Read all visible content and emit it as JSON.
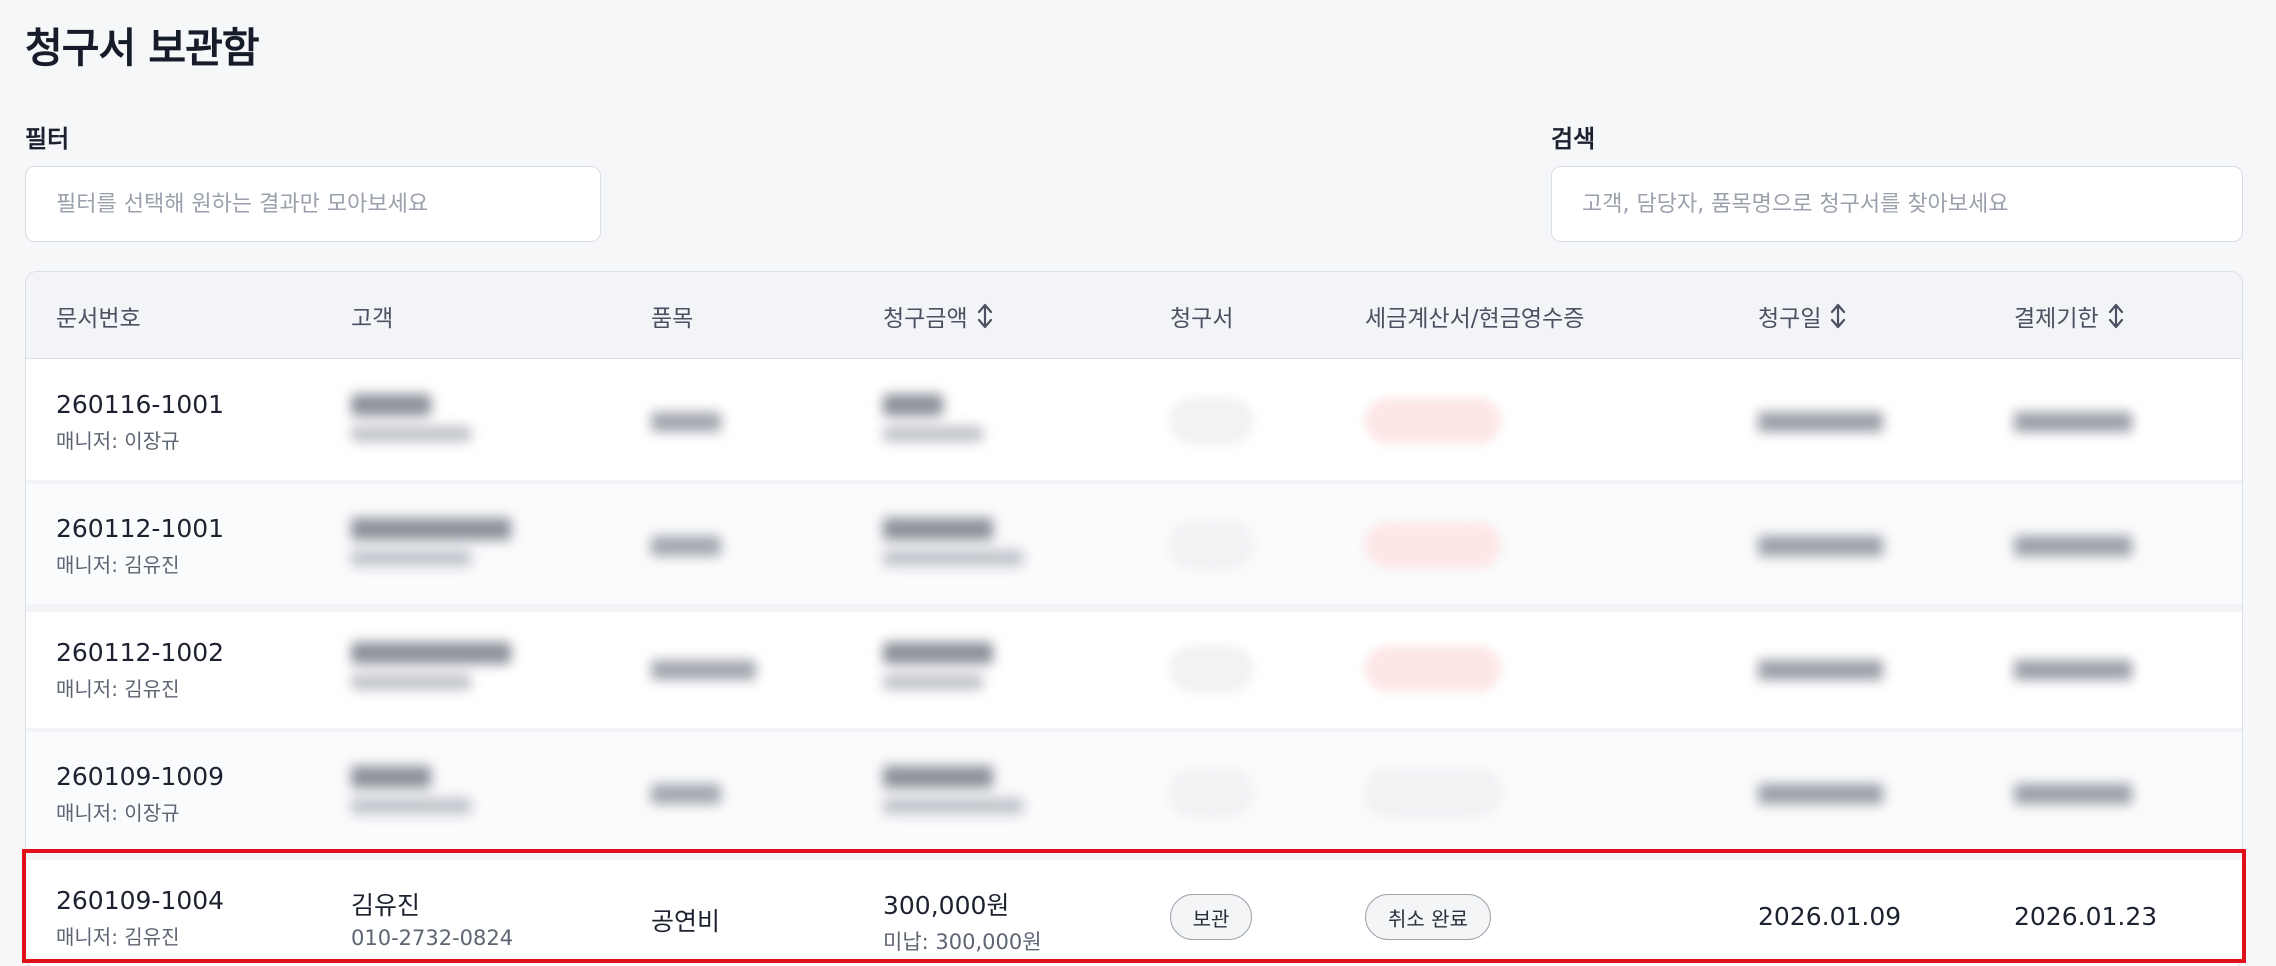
{
  "page": {
    "title": "청구서 보관함"
  },
  "filter": {
    "label": "필터",
    "placeholder": "필터를 선택해 원하는 결과만 모아보세요",
    "value": ""
  },
  "search": {
    "label": "검색",
    "placeholder": "고객, 담당자, 품목명으로 청구서를 찾아보세요",
    "value": ""
  },
  "table": {
    "columns": [
      {
        "label": "문서번호",
        "sortable": false
      },
      {
        "label": "고객",
        "sortable": false
      },
      {
        "label": "품목",
        "sortable": false
      },
      {
        "label": "청구금액",
        "sortable": true
      },
      {
        "label": "청구서",
        "sortable": false
      },
      {
        "label": "세금계산서/현금영수증",
        "sortable": false
      },
      {
        "label": "청구일",
        "sortable": true
      },
      {
        "label": "결제기한",
        "sortable": true
      }
    ],
    "rows": [
      {
        "doc_no": "260116-1001",
        "manager": "매니저: 이장규",
        "customer_name": "",
        "customer_phone": "",
        "item": "",
        "amount": "",
        "unpaid": "",
        "invoice_status": "",
        "tax_status": "",
        "billed_date": "",
        "due_date": "",
        "blurred": true,
        "tax_color": "#d23a3a"
      },
      {
        "doc_no": "260112-1001",
        "manager": "매니저: 김유진",
        "customer_name": "",
        "customer_phone": "",
        "item": "",
        "amount": "",
        "unpaid": "",
        "invoice_status": "",
        "tax_status": "",
        "billed_date": "",
        "due_date": "",
        "blurred": true,
        "tax_color": "#d23a3a"
      },
      {
        "doc_no": "260112-1002",
        "manager": "매니저: 김유진",
        "customer_name": "",
        "customer_phone": "",
        "item": "",
        "amount": "",
        "unpaid": "",
        "invoice_status": "",
        "tax_status": "",
        "billed_date": "",
        "due_date": "",
        "blurred": true,
        "tax_color": "#d23a3a"
      },
      {
        "doc_no": "260109-1009",
        "manager": "매니저: 이장규",
        "customer_name": "",
        "customer_phone": "",
        "item": "",
        "amount": "",
        "unpaid": "",
        "invoice_status": "",
        "tax_status": "",
        "billed_date": "",
        "due_date": "",
        "blurred": true,
        "tax_color": "#555c69"
      },
      {
        "doc_no": "260109-1004",
        "manager": "매니저: 김유진",
        "customer_name": "김유진",
        "customer_phone": "010-2732-0824",
        "item": "공연비",
        "amount": "300,000원",
        "unpaid": "미납: 300,000원",
        "invoice_status": "보관",
        "tax_status": "취소 완료",
        "billed_date": "2026.01.09",
        "due_date": "2026.01.23",
        "blurred": false,
        "highlighted": true
      }
    ]
  },
  "colors": {
    "highlight": "#e0101a",
    "accent_red": "#d23a3a"
  },
  "icons": {
    "sort": "sort-updown-icon"
  }
}
